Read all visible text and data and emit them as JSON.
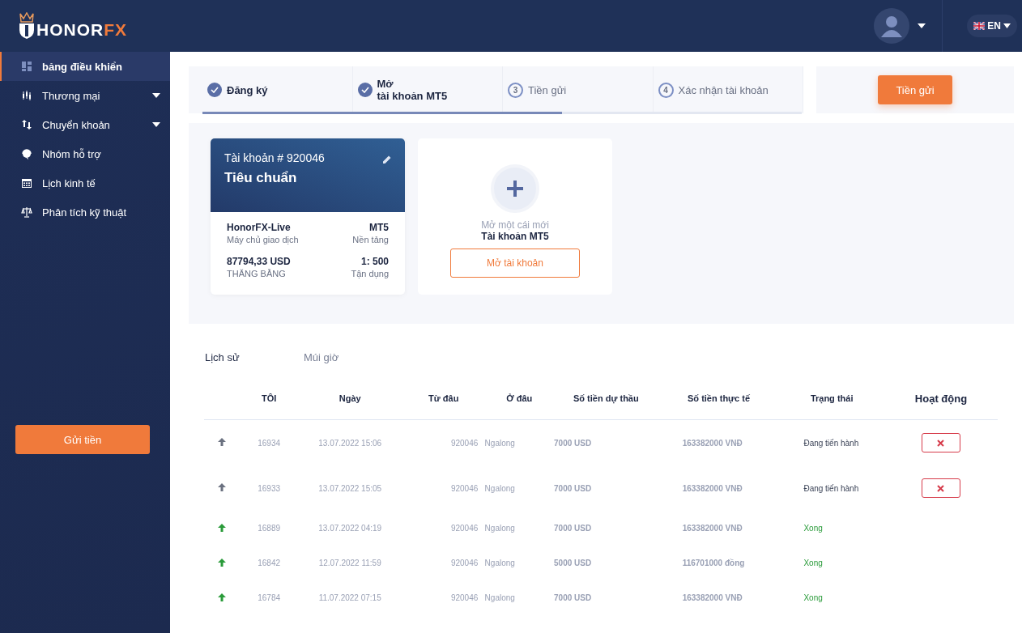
{
  "brand": {
    "name_main": "HONOR",
    "name_accent": "FX"
  },
  "sidebar": {
    "items": [
      {
        "label": "bảng điều khiển",
        "selected": true,
        "dropdown": false
      },
      {
        "label": "Thương mại",
        "selected": false,
        "dropdown": true
      },
      {
        "label": "Chuyển khoản",
        "selected": false,
        "dropdown": true
      },
      {
        "label": "Nhóm hỗ trợ",
        "selected": false,
        "dropdown": false
      },
      {
        "label": "Lịch kinh tế",
        "selected": false,
        "dropdown": false
      },
      {
        "label": "Phân tích kỹ thuật",
        "selected": false,
        "dropdown": false
      }
    ],
    "deposit_button": "Gửi tiền"
  },
  "header": {
    "language": "EN"
  },
  "stepper": {
    "level": 0.6,
    "steps": [
      {
        "label": "Đăng ký",
        "done": true
      },
      {
        "label": "Mở\ntài khoản MT5",
        "done": true
      },
      {
        "label": "Tiền gửi",
        "number": "3",
        "done": false
      },
      {
        "label": "Xác nhận tài khoản",
        "number": "4",
        "done": false
      }
    ]
  },
  "deposit_action": "Tiền gửi",
  "account": {
    "title": "Tài khoản # 920046",
    "type": "Tiêu chuẩn",
    "fields": [
      {
        "value": "HonorFX-Live",
        "label": "Máy chủ giao dịch"
      },
      {
        "value": "MT5",
        "label": "Nền tảng"
      },
      {
        "value": "87794,33 USD",
        "label": "THĂNG BẰNG"
      },
      {
        "value": "1: 500",
        "label": "Tận dụng"
      }
    ]
  },
  "new_account": {
    "line1": "Mở một cái mới",
    "line2": "Tài khoản MT5",
    "button": "Mở tài khoản"
  },
  "tabs": [
    {
      "label": "Lịch sử",
      "selected": true
    },
    {
      "label": "Múi giờ",
      "selected": false
    }
  ],
  "table": {
    "columns": [
      "TÔI",
      "Ngày",
      "Từ đâu",
      "Ở đâu",
      "Số tiền dự thầu",
      "Số tiền thực tế",
      "Trạng thái",
      "Hoạt động"
    ],
    "rows": [
      {
        "kind": "pending",
        "id": "16934",
        "date": "13.07.2022 15:06",
        "from": "920046",
        "to": "Ngalong",
        "amount": "7000 USD",
        "actual": "163382000 VNĐ",
        "status": "Đang tiến hành"
      },
      {
        "kind": "pending",
        "id": "16933",
        "date": "13.07.2022 15:05",
        "from": "920046",
        "to": "Ngalong",
        "amount": "7000 USD",
        "actual": "163382000 VNĐ",
        "status": "Đang tiến hành"
      },
      {
        "kind": "done",
        "id": "16889",
        "date": "13.07.2022 04:19",
        "from": "920046",
        "to": "Ngalong",
        "amount": "7000 USD",
        "actual": "163382000 VNĐ",
        "status": "Xong"
      },
      {
        "kind": "done",
        "id": "16842",
        "date": "12.07.2022 11:59",
        "from": "920046",
        "to": "Ngalong",
        "amount": "5000 USD",
        "actual": "116701000 đồng",
        "status": "Xong"
      },
      {
        "kind": "done",
        "id": "16784",
        "date": "11.07.2022 07:15",
        "from": "920046",
        "to": "Ngalong",
        "amount": "7000 USD",
        "actual": "163382000 VNĐ",
        "status": "Xong"
      }
    ]
  }
}
